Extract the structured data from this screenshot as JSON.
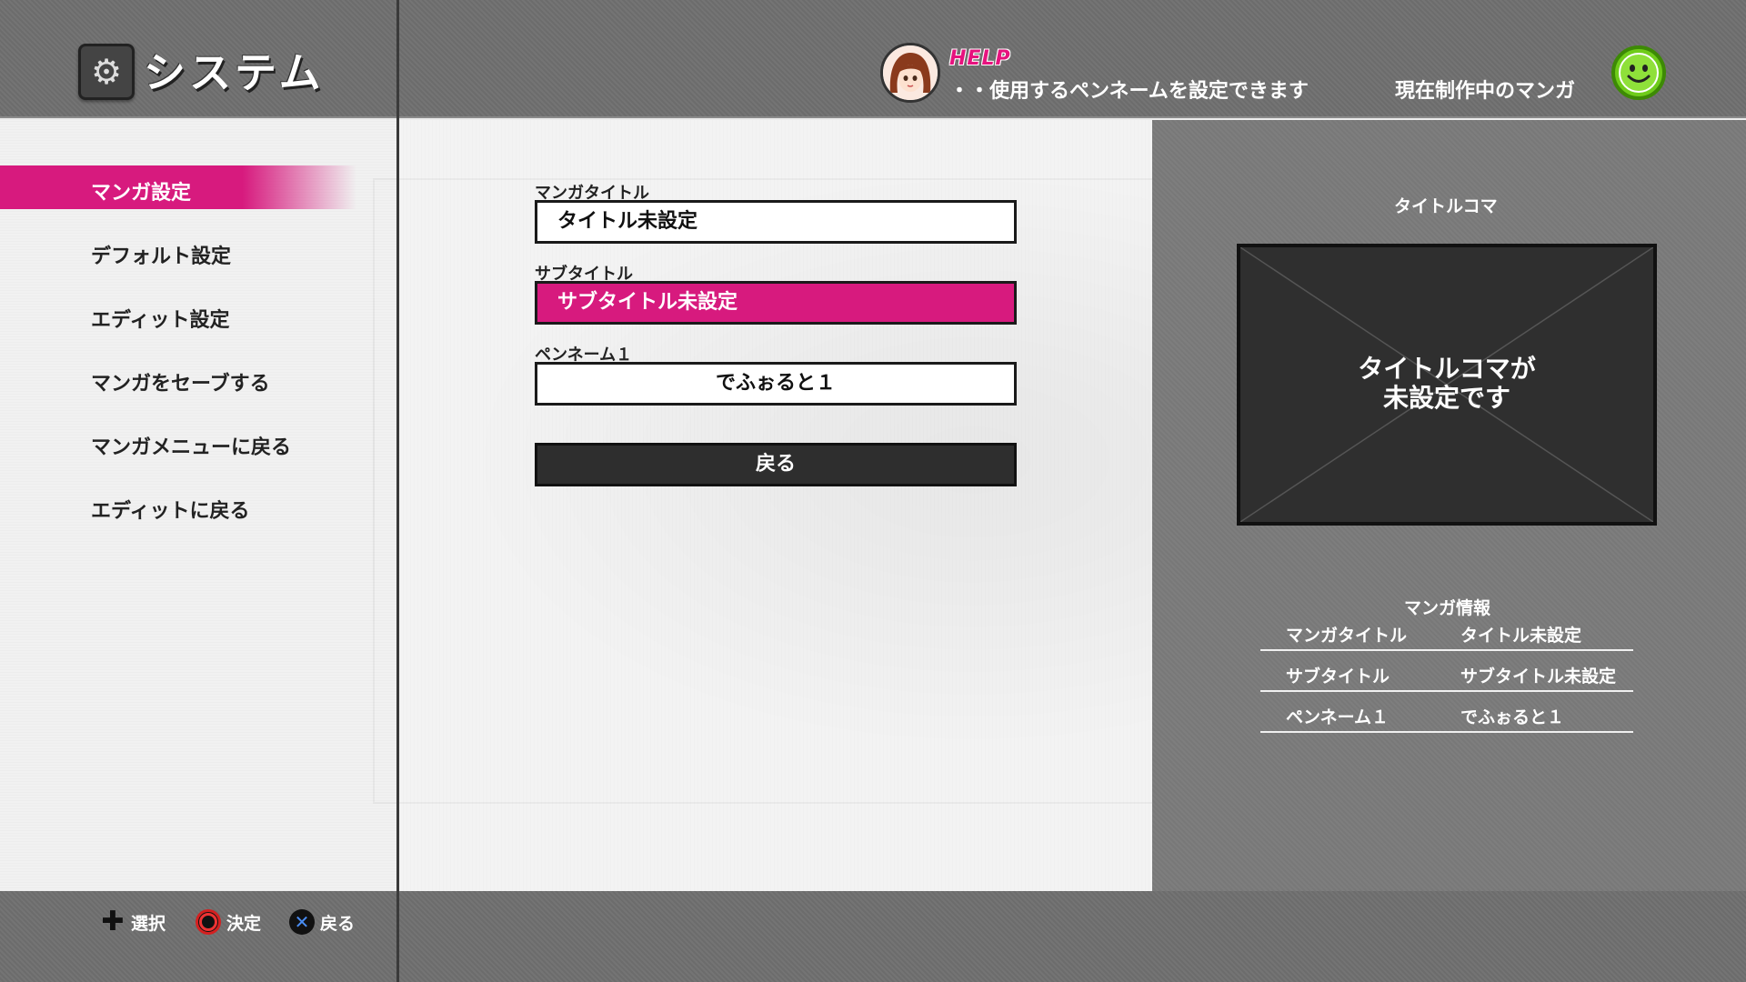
{
  "header": {
    "title": "システム",
    "help_label": "HELP",
    "help_text": "・・使用するペンネームを設定できます",
    "current_manga": "現在制作中のマンガ"
  },
  "sidebar": {
    "items": [
      {
        "label": "マンガ設定",
        "selected": true
      },
      {
        "label": "デフォルト設定",
        "selected": false
      },
      {
        "label": "エディット設定",
        "selected": false
      },
      {
        "label": "マンガをセーブする",
        "selected": false
      },
      {
        "label": "マンガメニューに戻る",
        "selected": false
      },
      {
        "label": "エディットに戻る",
        "selected": false
      }
    ]
  },
  "form": {
    "manga_title_label": "マンガタイトル",
    "manga_title_value": "タイトル未設定",
    "subtitle_label": "サブタイトル",
    "subtitle_value": "サブタイトル未設定",
    "penname_label": "ペンネーム１",
    "penname_value": "でふぉると１",
    "back_label": "戻る"
  },
  "preview": {
    "title_koma_label": "タイトルコマ",
    "title_koma_msg_line1": "タイトルコマが",
    "title_koma_msg_line2": "未設定です"
  },
  "info": {
    "label": "マンガ情報",
    "rows": [
      {
        "key": "マンガタイトル",
        "value": "タイトル未設定"
      },
      {
        "key": "サブタイトル",
        "value": "サブタイトル未設定"
      },
      {
        "key": "ペンネーム１",
        "value": "でふぉると１"
      }
    ]
  },
  "footer": {
    "select_label": "選択",
    "confirm_label": "決定",
    "back_label": "戻る"
  },
  "icons": {
    "system": "gear-icon",
    "avatar": "girl-avatar-icon",
    "status": "smiley-icon",
    "dpad": "dpad-icon",
    "circle": "circle-button-icon",
    "cross": "cross-button-icon"
  },
  "colors": {
    "accent": "#d71a7e",
    "status": "#6fcc1a"
  }
}
